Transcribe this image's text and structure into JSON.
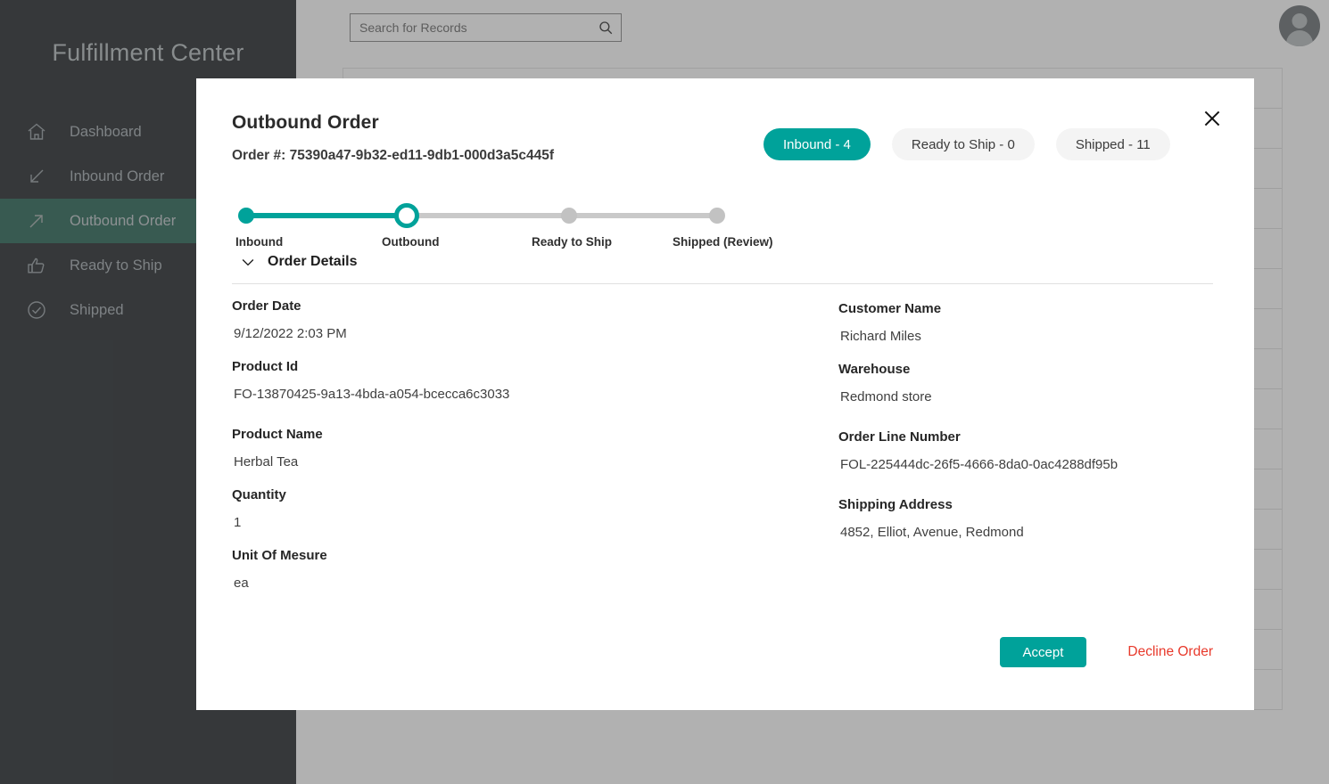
{
  "sidebar": {
    "title": "Fulfillment Center",
    "items": [
      {
        "label": "Dashboard",
        "icon": "home-icon",
        "active": false
      },
      {
        "label": "Inbound Order",
        "icon": "arrow-down-left-icon",
        "active": false
      },
      {
        "label": "Outbound Order",
        "icon": "arrow-up-right-icon",
        "active": true
      },
      {
        "label": "Ready to Ship",
        "icon": "thumbs-up-icon",
        "active": false
      },
      {
        "label": "Shipped",
        "icon": "check-circle-icon",
        "active": false
      }
    ]
  },
  "topbar": {
    "search_placeholder": "Search for Records",
    "search_value": "",
    "search_icon": "search-icon",
    "avatar_icon": "user-avatar-icon"
  },
  "modal": {
    "title": "Outbound Order",
    "order_number_label": "Order #: 75390a47-9b32-ed11-9db1-000d3a5c445f",
    "close_icon": "close-icon",
    "details_toggle_label": "Order Details",
    "details_toggle_icon": "chevron-down-icon",
    "pills": [
      {
        "label": "Inbound - 4",
        "state": "active"
      },
      {
        "label": "Ready to Ship - 0",
        "state": "inactive"
      },
      {
        "label": "Shipped - 11",
        "state": "inactive"
      }
    ],
    "steps": [
      {
        "label": "Inbound",
        "state": "done"
      },
      {
        "label": "Outbound",
        "state": "current"
      },
      {
        "label": "Ready to Ship",
        "state": "pending"
      },
      {
        "label": "Shipped (Review)",
        "state": "pending"
      }
    ],
    "fields_left": [
      {
        "label": "Order Date",
        "value": " 9/12/2022 2:03 PM"
      },
      {
        "label": "Product Id",
        "value": "FO-13870425-9a13-4bda-a054-bcecca6c3033"
      },
      {
        "label": "Product Name",
        "value": "Herbal Tea"
      },
      {
        "label": "Quantity",
        "value": "1"
      },
      {
        "label": "Unit Of Mesure",
        "value": "ea"
      }
    ],
    "fields_right": [
      {
        "label": "Customer Name",
        "value": " Richard Miles"
      },
      {
        "label": "Warehouse",
        "value": "Redmond store"
      },
      {
        "label": "Order Line Number",
        "value": "FOL-225444dc-26f5-4666-8da0-0ac4288df95b"
      },
      {
        "label": "Shipping Address",
        "value": "4852, Elliot, Avenue, Redmond"
      }
    ],
    "accept_label": "Accept",
    "decline_label": "Decline Order"
  },
  "colors": {
    "teal": "#00a29a",
    "sidebar_bg": "#2b3033",
    "sidebar_active": "#2f6a5a",
    "decline_red": "#e8392b"
  }
}
